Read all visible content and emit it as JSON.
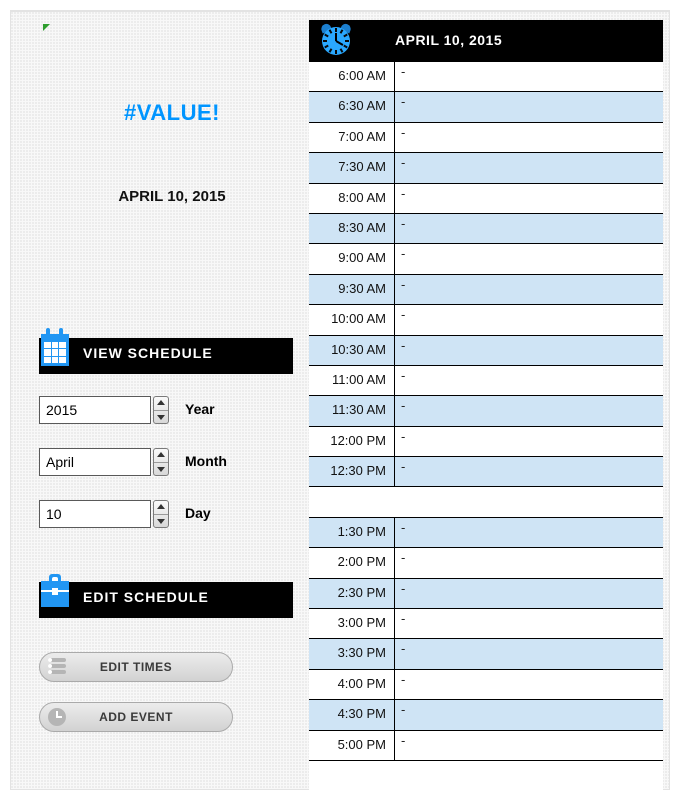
{
  "left": {
    "value_error": "#VALUE!",
    "display_date": "APRIL 10, 2015",
    "view_label": "VIEW SCHEDULE",
    "edit_label": "EDIT SCHEDULE",
    "year": {
      "value": "2015",
      "label": "Year"
    },
    "month": {
      "value": "April",
      "label": "Month"
    },
    "day": {
      "value": "10",
      "label": "Day"
    },
    "edit_times_label": "EDIT TIMES",
    "add_event_label": "ADD EVENT"
  },
  "right": {
    "title": "APRIL 10, 2015",
    "rows": [
      {
        "time": "6:00 AM",
        "event": "-",
        "alt": false
      },
      {
        "time": "6:30 AM",
        "event": "-",
        "alt": true
      },
      {
        "time": "7:00 AM",
        "event": "-",
        "alt": false
      },
      {
        "time": "7:30 AM",
        "event": "-",
        "alt": true
      },
      {
        "time": "8:00 AM",
        "event": "-",
        "alt": false
      },
      {
        "time": "8:30 AM",
        "event": "-",
        "alt": true
      },
      {
        "time": "9:00 AM",
        "event": "-",
        "alt": false
      },
      {
        "time": "9:30 AM",
        "event": "-",
        "alt": true
      },
      {
        "time": "10:00 AM",
        "event": "-",
        "alt": false
      },
      {
        "time": "10:30 AM",
        "event": "-",
        "alt": true
      },
      {
        "time": "11:00 AM",
        "event": "-",
        "alt": false
      },
      {
        "time": "11:30 AM",
        "event": "-",
        "alt": true
      },
      {
        "time": "12:00 PM",
        "event": "-",
        "alt": false
      },
      {
        "time": "12:30 PM",
        "event": "-",
        "alt": true
      },
      {
        "time": "",
        "event": "",
        "alt": false,
        "blank": true
      },
      {
        "time": "1:30 PM",
        "event": "-",
        "alt": true
      },
      {
        "time": "2:00 PM",
        "event": "-",
        "alt": false
      },
      {
        "time": "2:30 PM",
        "event": "-",
        "alt": true
      },
      {
        "time": "3:00 PM",
        "event": "-",
        "alt": false
      },
      {
        "time": "3:30 PM",
        "event": "-",
        "alt": true
      },
      {
        "time": "4:00 PM",
        "event": "-",
        "alt": false
      },
      {
        "time": "4:30 PM",
        "event": "-",
        "alt": true
      },
      {
        "time": "5:00 PM",
        "event": "-",
        "alt": false
      }
    ]
  }
}
